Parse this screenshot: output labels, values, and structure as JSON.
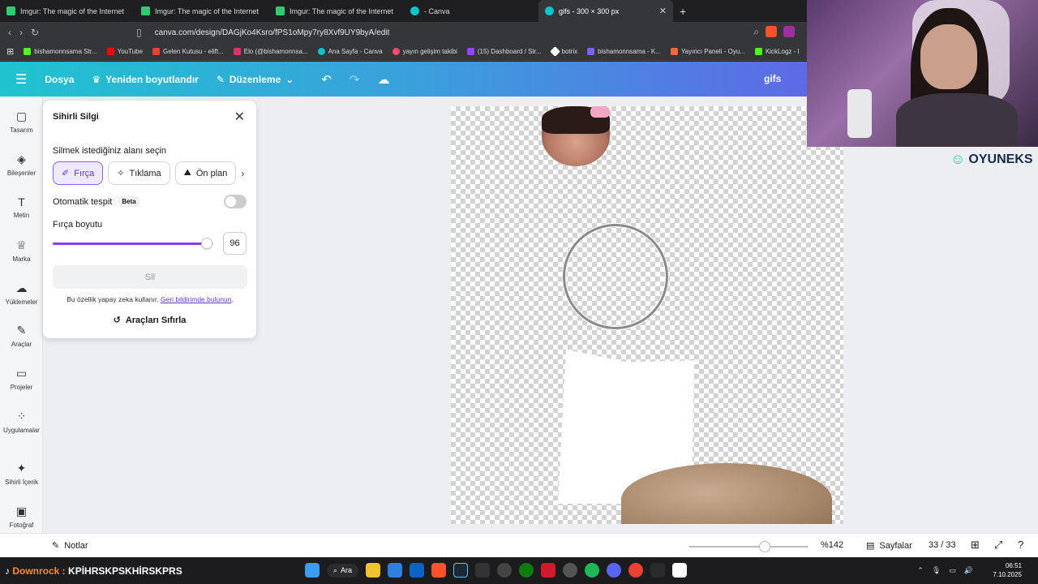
{
  "browser": {
    "tabs": [
      {
        "label": "Imgur: The magic of the Internet",
        "color": "#2ecc71"
      },
      {
        "label": "Imgur: The magic of the Internet",
        "color": "#2ecc71"
      },
      {
        "label": "Imgur: The magic of the Internet",
        "color": "#2ecc71"
      },
      {
        "label": "- Canva",
        "color": "#00c4cc"
      },
      {
        "label": "gifs - 300 × 300 px",
        "color": "#00c4cc",
        "active": true
      }
    ],
    "url": "canva.com/design/DAGjKo4Ksro/fPS1oMpy7ry8Xvf9UY9byA/edit",
    "bookmarks": [
      {
        "label": "bishamonnsama Str...",
        "color": "#53fc18"
      },
      {
        "label": "YouTube",
        "color": "#ff0000"
      },
      {
        "label": "Gelen Kutusu - elift...",
        "color": "#ea4335"
      },
      {
        "label": "Elo (@bishamonnsa...",
        "color": "#e1306c"
      },
      {
        "label": "Ana Sayfa - Canva",
        "color": "#00c4cc"
      },
      {
        "label": "yayın gelişim takibi",
        "color": "#ff4d6d"
      },
      {
        "label": "(15) Dashboard / Str...",
        "color": "#9146ff"
      },
      {
        "label": "botrix",
        "color": "#ffffff"
      },
      {
        "label": "bishamonnsama - K...",
        "color": "#7b61ff"
      },
      {
        "label": "Yayıncı Paneli - Oyu...",
        "color": "#ff6a3d"
      },
      {
        "label": "KickLogz - I",
        "color": "#53fc18"
      }
    ]
  },
  "canva": {
    "menu_file": "Dosya",
    "menu_resize": "Yeniden boyutlandır",
    "menu_edit": "Düzenleme",
    "design_title": "gifs",
    "rail": [
      {
        "label": "Tasarım",
        "icon": "layout-icon"
      },
      {
        "label": "Bileşenler",
        "icon": "shapes-icon"
      },
      {
        "label": "Metin",
        "icon": "text-icon"
      },
      {
        "label": "Marka",
        "icon": "brand-icon"
      },
      {
        "label": "Yüklemeler",
        "icon": "upload-icon"
      },
      {
        "label": "Araçlar",
        "icon": "tools-icon"
      },
      {
        "label": "Projeler",
        "icon": "folder-icon"
      },
      {
        "label": "Uygulamalar",
        "icon": "apps-icon"
      },
      {
        "label": "Sihirli İçerik",
        "icon": "magic-icon"
      },
      {
        "label": "Fotoğraf",
        "icon": "photo-icon"
      }
    ]
  },
  "panel": {
    "title": "Sihirli Silgi",
    "subtitle": "Silmek istediğiniz alanı seçin",
    "chips": [
      "Fırça",
      "Tıklama",
      "Ön plan"
    ],
    "auto_detect": "Otomatik tespit",
    "beta": "Beta",
    "auto_detect_on": false,
    "brush_size_label": "Fırça boyutu",
    "brush_size": "96",
    "brush_size_max": 100,
    "erase_button": "Sil",
    "note_text": "Bu özellik yapay zeka kullanır. ",
    "note_link": "Geri bildirimde bulunun",
    "note_end": ".",
    "reset_button": "Araçları Sıfırla",
    "accent": "#8b3cf6"
  },
  "bottom": {
    "notes": "Notlar",
    "zoom": "%142",
    "zoom_fraction": 0.64,
    "pages": "Sayfalar",
    "page_count": "33 / 33"
  },
  "overlay": {
    "brand": "OYUNEKS"
  },
  "taskbar": {
    "stream_label": "Downrock :",
    "stream_text": "KPİHRSKPSKHİRSKPRS",
    "search": "Ara",
    "time": "06:51",
    "date": "7.10.2025"
  }
}
